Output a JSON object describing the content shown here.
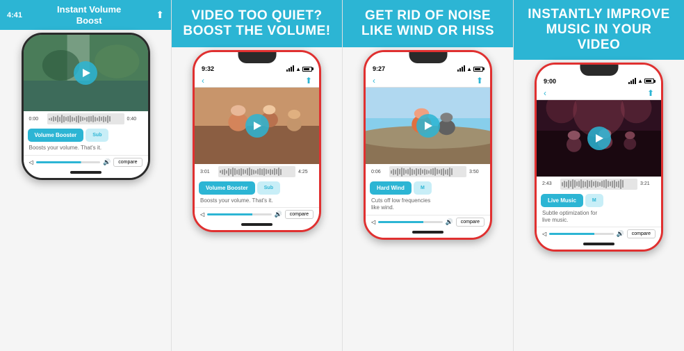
{
  "sections": [
    {
      "id": "section-1",
      "type": "app-header",
      "header": {
        "time": "4:41",
        "title": "Instant Volume\nBoost",
        "share": "⬆"
      },
      "phone": {
        "border": "normal",
        "video_style": "waterfall",
        "status_time": "",
        "nav_back": false,
        "time_start": "0:00",
        "time_end": "0:40",
        "filter_label": "Volume Booster",
        "filter_active": true,
        "filter_sub": "Sub",
        "description": "Boosts your volume. That's it.",
        "show_compare": true,
        "show_home": true
      }
    },
    {
      "id": "section-2",
      "type": "promo",
      "header_text": "VIDEO TOO QUIET?\nBOOST THE VOLUME!",
      "phone": {
        "border": "red",
        "video_style": "group",
        "status_time": "9:32",
        "nav_back": true,
        "time_start": "3:01",
        "time_end": "4:25",
        "filter_label": "Volume Booster",
        "filter_active": true,
        "filter_sub": "Sub",
        "description": "Boosts your volume. That's it.",
        "show_compare": true,
        "show_home": true
      }
    },
    {
      "id": "section-3",
      "type": "promo",
      "header_text": "GET RID OF NOISE\nLIKE WIND OR HISS",
      "phone": {
        "border": "red",
        "video_style": "wind",
        "status_time": "9:27",
        "nav_back": true,
        "time_start": "0:06",
        "time_end": "3:50",
        "filter_label": "Hard Wind",
        "filter_active": true,
        "filter_sub": "M",
        "description": "Cuts off low frequencies\nlike wind.",
        "show_compare": true,
        "show_home": true
      }
    },
    {
      "id": "section-4",
      "type": "promo",
      "header_text": "INSTANTLY IMPROVE\nMUSIC IN YOUR VIDEO",
      "phone": {
        "border": "red",
        "video_style": "music",
        "status_time": "9:00",
        "nav_back": true,
        "time_start": "2:43",
        "time_end": "3:21",
        "filter_label": "Live Music",
        "filter_active": true,
        "filter_sub": "M",
        "description": "Subtle optimization for\nlive music.",
        "show_compare": true,
        "show_home": true
      }
    }
  ],
  "labels": {
    "back": "‹",
    "share": "⬆",
    "compare": "compare",
    "volume_icon": "◀)",
    "home_bar_label": "home indicator"
  },
  "waveform_heights": [
    3,
    5,
    8,
    6,
    10,
    7,
    12,
    9,
    6,
    8,
    10,
    7,
    5,
    9,
    11,
    8,
    6,
    4,
    7,
    9,
    8,
    10,
    7,
    5,
    8,
    6,
    9,
    7,
    11,
    8,
    6,
    5,
    9,
    10,
    7,
    8,
    6,
    4,
    7,
    9
  ],
  "colors": {
    "cyan": "#2cb5d4",
    "red_border": "#e03030",
    "dark": "#1a1a1a",
    "light_cyan": "#c8eef7"
  }
}
